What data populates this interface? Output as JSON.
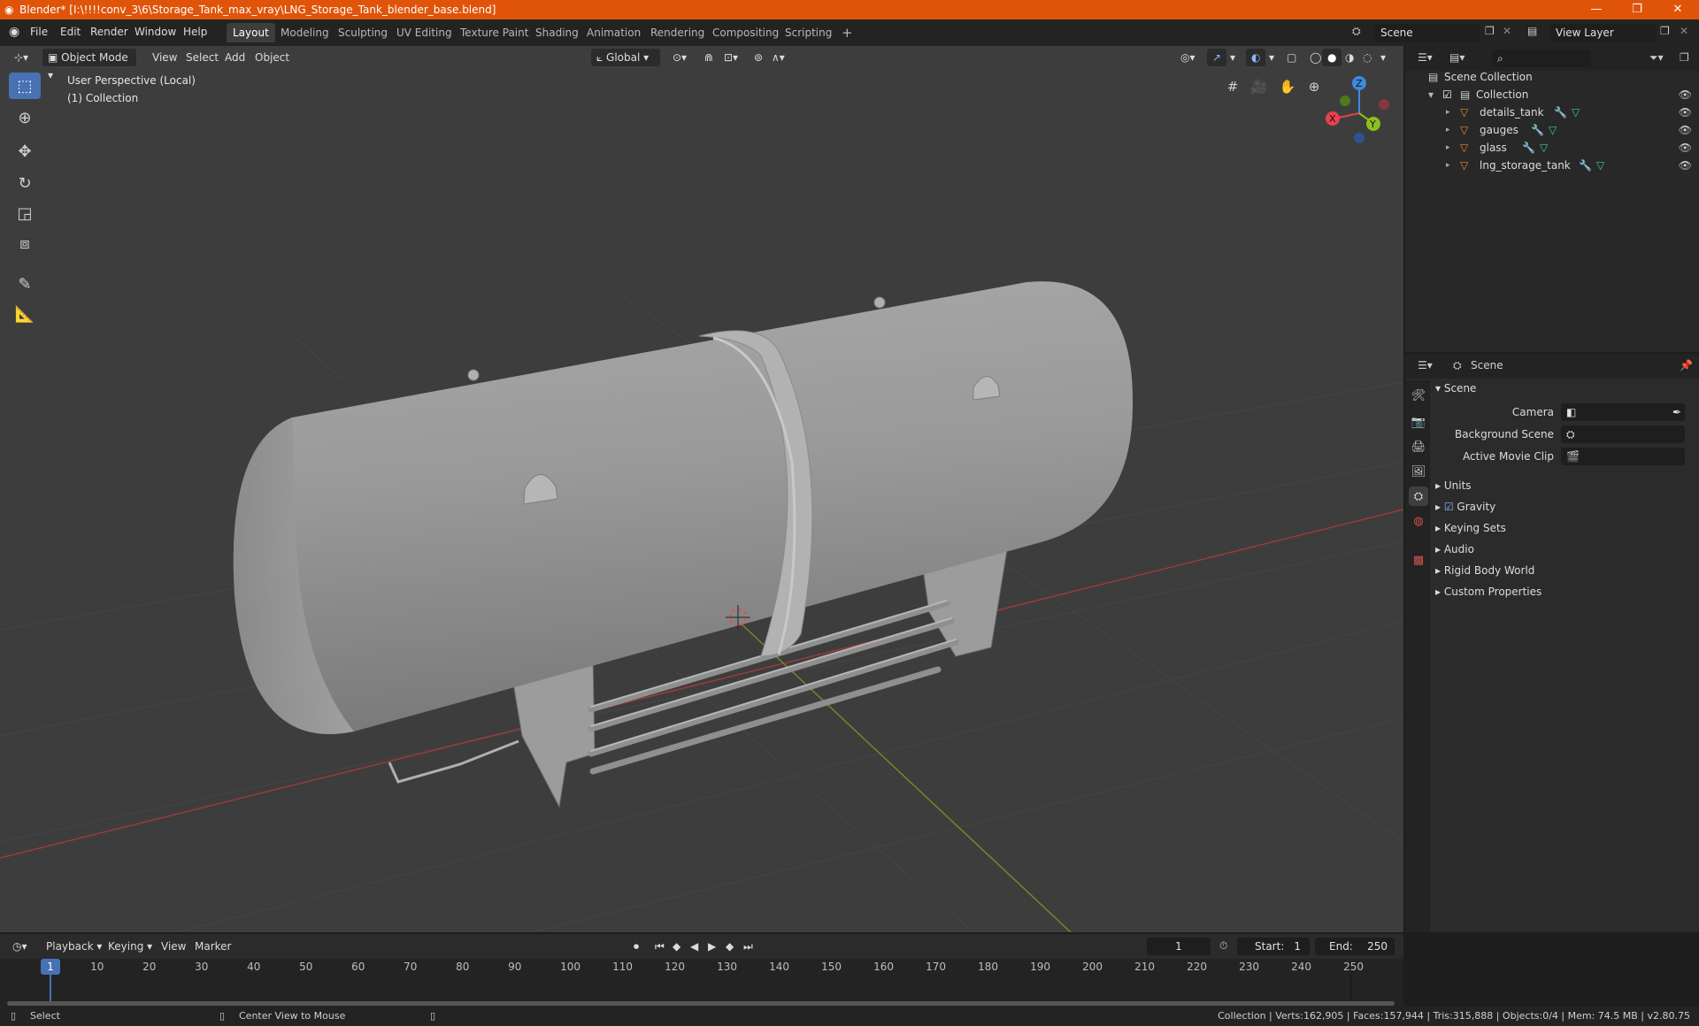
{
  "titlebar": {
    "title": "Blender* [I:\\!!!!conv_3\\6\\Storage_Tank_max_vray\\LNG_Storage_Tank_blender_base.blend]",
    "minimize": "—",
    "maximize": "❐",
    "close": "✕"
  },
  "menubar": {
    "items": [
      "File",
      "Edit",
      "Render",
      "Window",
      "Help"
    ],
    "workspaces": [
      "Layout",
      "Modeling",
      "Sculpting",
      "UV Editing",
      "Texture Paint",
      "Shading",
      "Animation",
      "Rendering",
      "Compositing",
      "Scripting"
    ],
    "add_tab": "+",
    "scene": "Scene",
    "view_layer": "View Layer"
  },
  "viewport": {
    "mode": "Object Mode",
    "menus": [
      "View",
      "Select",
      "Add",
      "Object"
    ],
    "orientation": "Global",
    "perspective_label": "User Perspective (Local)",
    "collection_label": "(1) Collection",
    "gizmo": {
      "x": "X",
      "y": "Y",
      "z": "Z"
    }
  },
  "outliner": {
    "root": "Scene Collection",
    "collection": "Collection",
    "objects": [
      "details_tank",
      "gauges",
      "glass",
      "lng_storage_tank"
    ]
  },
  "properties": {
    "header": "Scene",
    "section": "Scene",
    "fields": [
      "Camera",
      "Background Scene",
      "Active Movie Clip"
    ],
    "panels": [
      "Units",
      "Gravity",
      "Keying Sets",
      "Audio",
      "Rigid Body World",
      "Custom Properties"
    ]
  },
  "timeline": {
    "menus": [
      "Playback",
      "Keying",
      "View",
      "Marker"
    ],
    "current_frame": "1",
    "start_label": "Start:",
    "start": "1",
    "end_label": "End:",
    "end": "250",
    "ticks": [
      "1",
      "10",
      "20",
      "30",
      "40",
      "50",
      "60",
      "70",
      "80",
      "90",
      "100",
      "110",
      "120",
      "130",
      "140",
      "150",
      "160",
      "170",
      "180",
      "190",
      "200",
      "210",
      "220",
      "230",
      "240",
      "250"
    ]
  },
  "statusbar": {
    "select": "Select",
    "center": "Center View to Mouse",
    "stats": "Collection | Verts:162,905 | Faces:157,944 | Tris:315,888 | Objects:0/4 | Mem: 74.5 MB | v2.80.75"
  },
  "colors": {
    "titlebar": "#e0540a",
    "active_tool": "#4772b3",
    "x_axis": "#e8414f",
    "y_axis": "#8bbf1e",
    "z_axis": "#3d8ae0",
    "mesh_icon": "#e48a2f"
  }
}
